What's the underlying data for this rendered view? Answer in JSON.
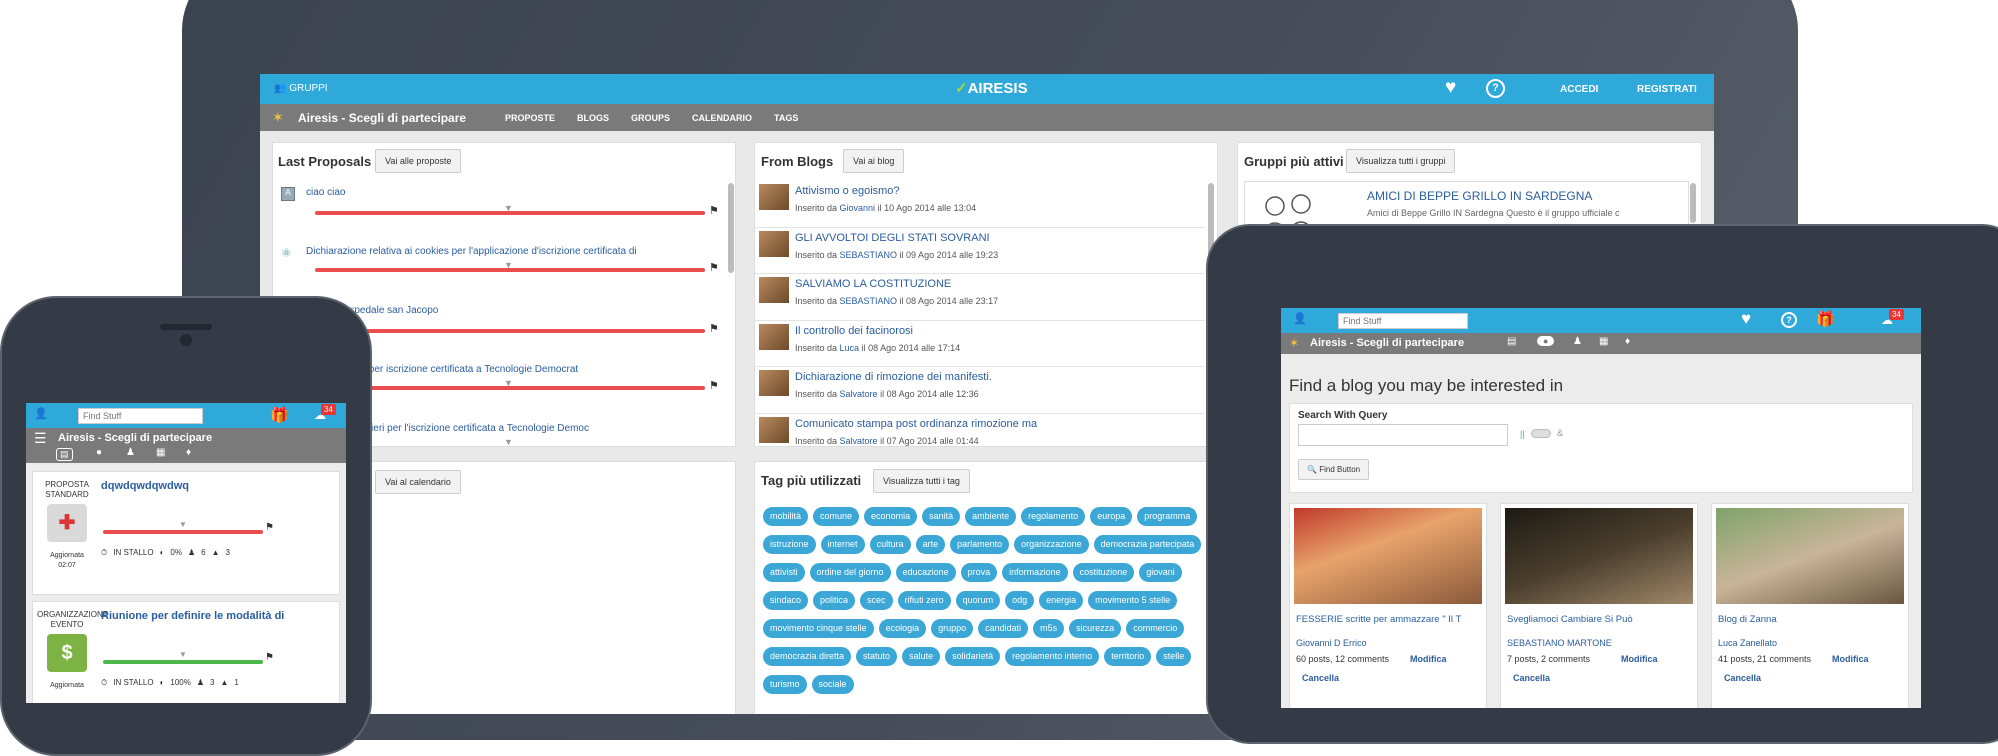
{
  "laptop": {
    "topbar": {
      "groups": "GRUPPI",
      "logo": "AIRESIS",
      "login": "ACCEDI",
      "register": "REGISTRATI"
    },
    "subbar": {
      "title": "Airesis - Scegli di partecipare",
      "nav": [
        "PROPOSTE",
        "BLOGS",
        "GROUPS",
        "CALENDARIO",
        "TAGS"
      ]
    },
    "proposals": {
      "title": "Last Proposals",
      "button": "Vai alle proposte",
      "items": [
        "ciao ciao",
        "Dichiarazione relativa ai cookies per l'applicazione d'iscrizione certificata di",
        "lo libero ospedale san Jacopo",
        "i sulla privacy per iscrizione certificata a Tecnologie Democrat",
        "ne di Dati Veritieri per l'iscrizione certificata a Tecnologie Democ"
      ]
    },
    "blogs": {
      "title": "From Blogs",
      "button": "Vai ai blog",
      "posts": [
        {
          "title": "Attivismo o egoismo?",
          "pre": "Inserito da ",
          "author": "Giovanni",
          "date": " il 10 Ago 2014 alle 13:04"
        },
        {
          "title": "GLI AVVOLTOI DEGLI STATI SOVRANI",
          "pre": "Inserito da ",
          "author": "SEBASTIANO",
          "date": " il 09 Ago 2014 alle 19:23"
        },
        {
          "title": "SALVIAMO LA COSTITUZIONE",
          "pre": "Inserito da ",
          "author": "SEBASTIANO",
          "date": " il 08 Ago 2014 alle 23:17"
        },
        {
          "title": "Il controllo dei facinorosi",
          "pre": "Inserito da ",
          "author": "Luca",
          "date": " il 08 Ago 2014 alle 17:14"
        },
        {
          "title": "Dichiarazione di rimozione dei manifesti.",
          "pre": "Inserito da ",
          "author": "Salvatore",
          "date": " il 08 Ago 2014 alle 12:36"
        },
        {
          "title": "Comunicato stampa post ordinanza rimozione ma",
          "pre": "Inserito da ",
          "author": "Salvatore",
          "date": " il 07 Ago 2014 alle 01:44"
        }
      ]
    },
    "groups": {
      "title": "Gruppi più attivi",
      "button": "Visualizza tutti i gruppi",
      "group_name": "AMICI DI BEPPE GRILLO IN SARDEGNA",
      "group_desc": "Amici di Beppe Grillo IN Sardegna Questo è il gruppo ufficiale c"
    },
    "calendar": {
      "button": "Vai al calendario"
    },
    "tags": {
      "title": "Tag più utilizzati",
      "button": "Visualizza tutti i tag",
      "list": [
        "mobilità",
        "comune",
        "economia",
        "sanità",
        "ambiente",
        "regolamento",
        "europa",
        "programma",
        "istruzione",
        "internet",
        "cultura",
        "arte",
        "parlamento",
        "organizzazione",
        "democrazia partecipata",
        "attivisti",
        "ordine del giorno",
        "educazione",
        "prova",
        "informazione",
        "costituzione",
        "giovani",
        "sindaco",
        "politica",
        "scec",
        "rifiuti zero",
        "quorum",
        "odg",
        "energia",
        "movimento 5 stelle",
        "movimento cinque stelle",
        "ecologia",
        "gruppo",
        "candidati",
        "m5s",
        "sicurezza",
        "commercio",
        "democrazia diretta",
        "statuto",
        "salute",
        "solidarietà",
        "regolamento interno",
        "territorio",
        "stelle",
        "turismo",
        "sociale"
      ]
    }
  },
  "phone": {
    "search_placeholder": "Find Stuff",
    "badge": "34",
    "title": "Airesis - Scegli di partecipare",
    "proposals": [
      {
        "type": "PROPOSTA STANDARD",
        "title": "dqwdqwdqwdwq",
        "updated": "Aggiornata",
        "time": "02:07",
        "status": "IN STALLO",
        "pct": "0%",
        "people": "6",
        "votes": "3"
      },
      {
        "type": "ORGANIZZAZIONE EVENTO",
        "title": "Riunione per definire le modalità di",
        "updated": "Aggiornata",
        "time": "",
        "status": "IN STALLO",
        "pct": "100%",
        "people": "3",
        "votes": "1"
      }
    ]
  },
  "tablet": {
    "search_placeholder": "Find Stuff",
    "badge": "34",
    "title": "Airesis - Scegli di partecipare",
    "heading": "Find a blog you may be interested in",
    "search_label": "Search With Query",
    "find_button": "Find Button",
    "toggle_label": "||",
    "blogs": [
      {
        "title": "FESSERIE scritte per ammazzare \" Il T",
        "author": "Giovanni D Errico",
        "stats": "60 posts, 12 comments",
        "edit": "Modifica",
        "delete": "Cancella"
      },
      {
        "title": "Svegliamoci Cambiare Si Può",
        "author": "SEBASTIANO MARTONE",
        "stats": "7 posts, 2 comments",
        "edit": "Modifica",
        "delete": "Cancella"
      },
      {
        "title": "Blog di Zanna",
        "author": "Luca Zanellato",
        "stats": "41 posts, 21 comments",
        "edit": "Modifica",
        "delete": "Cancella"
      }
    ]
  },
  "colors": {
    "topbar": "#2fa8da",
    "subbar": "#7a7a7a",
    "frame": "#3f4652",
    "red": "#e84e4e",
    "green": "#4cb84c",
    "tag": "#3aa7d6"
  }
}
